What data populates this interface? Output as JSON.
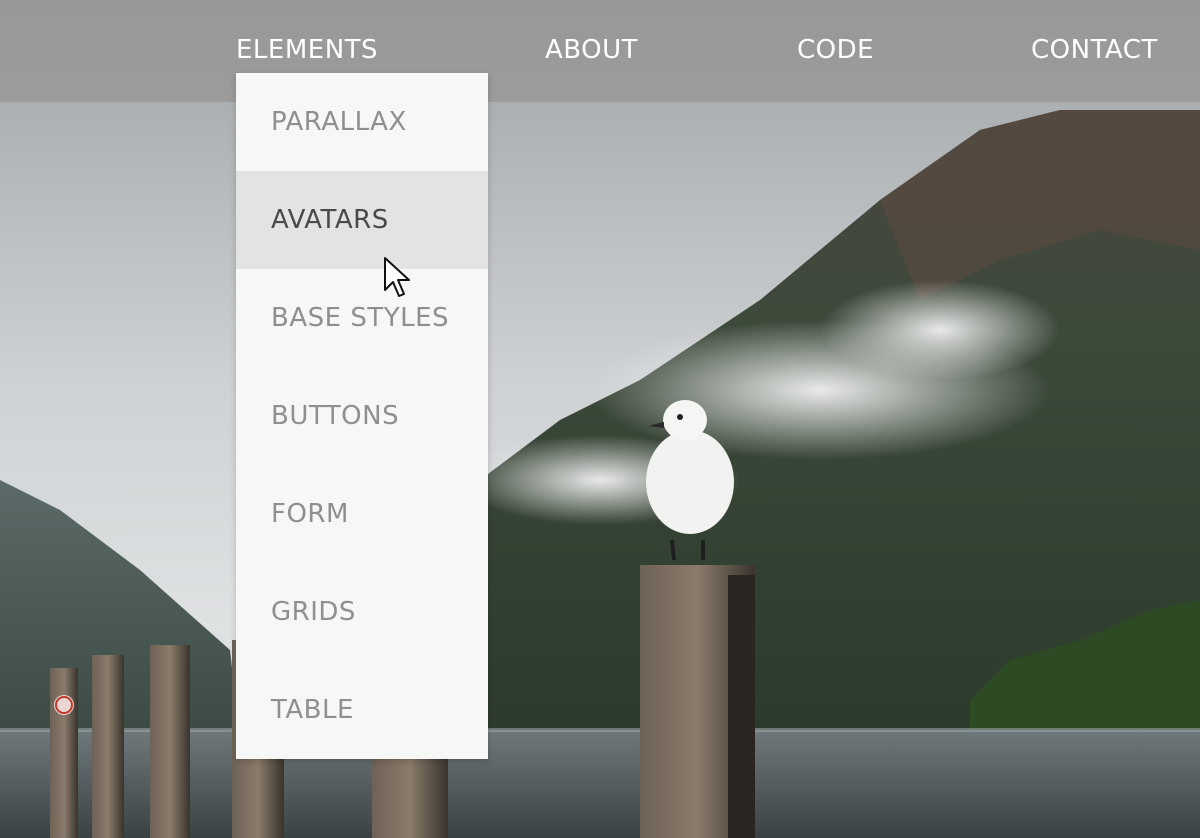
{
  "nav": {
    "items": [
      {
        "label": "ELEMENTS"
      },
      {
        "label": "ABOUT"
      },
      {
        "label": "CODE"
      },
      {
        "label": "CONTACT"
      }
    ]
  },
  "dropdown": {
    "items": [
      {
        "label": "PARALLAX"
      },
      {
        "label": "AVATARS",
        "hovered": true
      },
      {
        "label": "BASE STYLES"
      },
      {
        "label": "BUTTONS"
      },
      {
        "label": "FORM"
      },
      {
        "label": "GRIDS"
      },
      {
        "label": "TABLE"
      }
    ]
  },
  "colors": {
    "navbar_bg": "#969492",
    "menu_bg": "#f7f7f7",
    "menu_hover_bg": "#e3e3e3",
    "menu_text": "#8f8f8f",
    "menu_text_active": "#4a4a4a",
    "nav_text": "#ffffff"
  },
  "background": {
    "scene": "lake-mountain-seagull-photo"
  }
}
